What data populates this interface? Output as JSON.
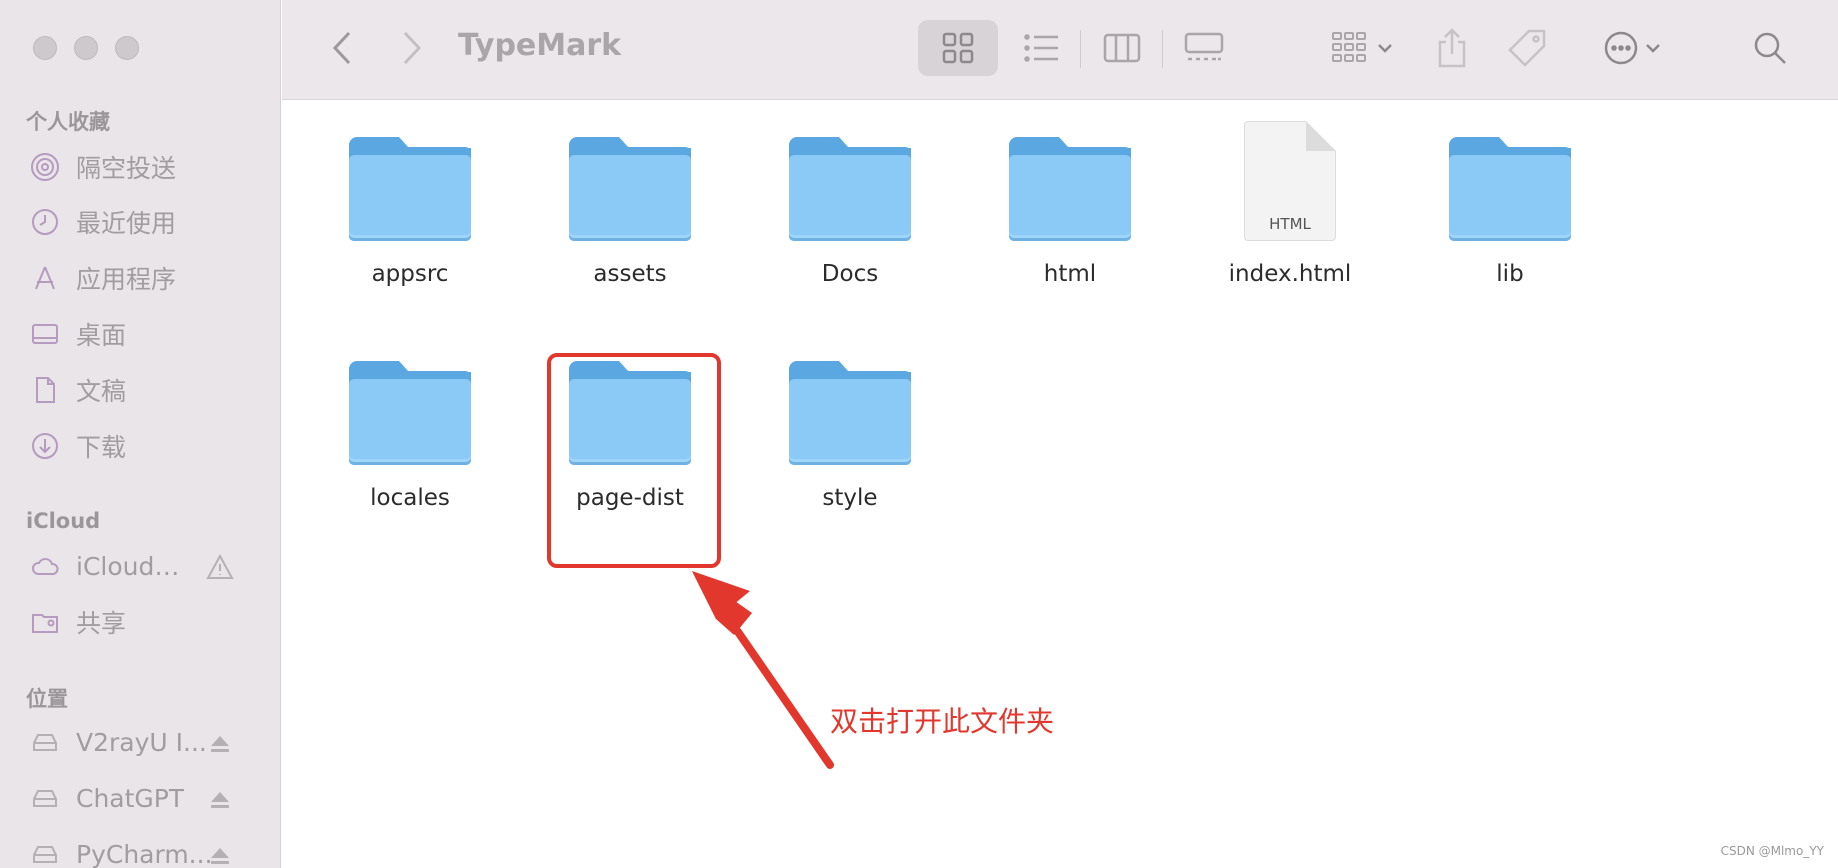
{
  "toolbar": {
    "title": "TypeMark"
  },
  "sidebar": {
    "favorites_title": "个人收藏",
    "favorites": [
      {
        "label": "隔空投送",
        "icon": "airdrop-icon"
      },
      {
        "label": "最近使用",
        "icon": "clock-icon"
      },
      {
        "label": "应用程序",
        "icon": "applications-icon"
      },
      {
        "label": "桌面",
        "icon": "desktop-icon"
      },
      {
        "label": "文稿",
        "icon": "document-icon"
      },
      {
        "label": "下载",
        "icon": "download-icon"
      }
    ],
    "icloud_title": "iCloud",
    "icloud": [
      {
        "label": "iCloud…",
        "icon": "cloud-icon",
        "trail": "warning-icon"
      },
      {
        "label": "共享",
        "icon": "shared-folder-icon"
      }
    ],
    "locations_title": "位置",
    "locations": [
      {
        "label": "V2rayU I...",
        "icon": "drive-icon",
        "trail": "eject-icon"
      },
      {
        "label": "ChatGPT",
        "icon": "drive-icon",
        "trail": "eject-icon"
      },
      {
        "label": "PyCharm...",
        "icon": "drive-icon",
        "trail": "eject-icon"
      }
    ]
  },
  "files": [
    {
      "name": "appsrc",
      "kind": "folder"
    },
    {
      "name": "assets",
      "kind": "folder"
    },
    {
      "name": "Docs",
      "kind": "folder"
    },
    {
      "name": "html",
      "kind": "folder"
    },
    {
      "name": "index.html",
      "kind": "document",
      "badge": "HTML"
    },
    {
      "name": "lib",
      "kind": "folder"
    },
    {
      "name": "locales",
      "kind": "folder"
    },
    {
      "name": "page-dist",
      "kind": "folder",
      "highlighted": true
    },
    {
      "name": "style",
      "kind": "folder"
    }
  ],
  "annotation": {
    "note": "双击打开此文件夹",
    "color": "#e1372d"
  },
  "watermark": "CSDN @Mlmo_YY",
  "colors": {
    "folder_front": "#8bcaf6",
    "folder_back": "#5ba7e2",
    "sidebar_bg": "#e9e5e8"
  }
}
